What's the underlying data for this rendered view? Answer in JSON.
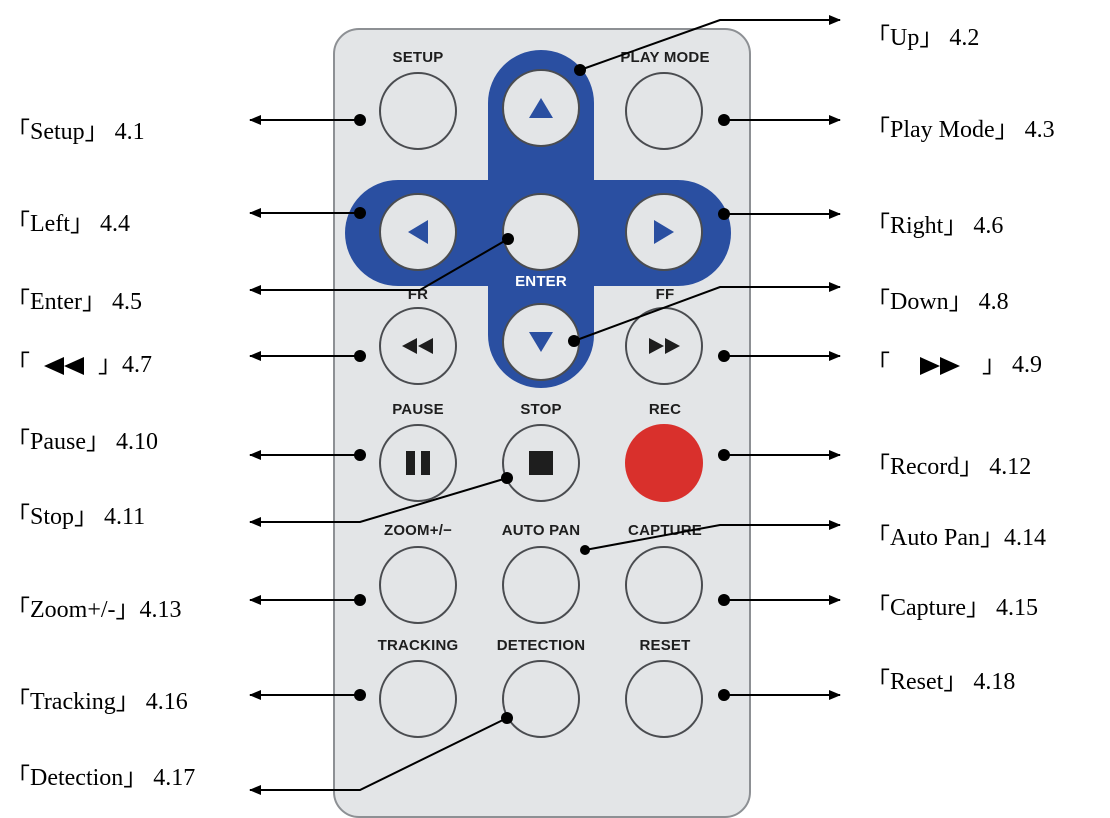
{
  "remote": {
    "body_color": "#e3e5e7",
    "dpad_color": "#2a4fa1",
    "record_color": "#d9302c",
    "buttons": {
      "setup": "SETUP",
      "play_mode": "PLAY MODE",
      "enter": "ENTER",
      "fr": "FR",
      "ff": "FF",
      "pause": "PAUSE",
      "stop": "STOP",
      "rec": "REC",
      "zoom": "ZOOM+/−",
      "auto_pan": "AUTO PAN",
      "capture": "CAPTURE",
      "tracking": "TRACKING",
      "detection": "DETECTION",
      "reset": "RESET"
    },
    "icons": {
      "up": "triangle-up-icon",
      "down": "triangle-down-icon",
      "left": "triangle-left-icon",
      "right": "triangle-right-icon",
      "fr": "rewind-icon",
      "ff": "fast-forward-icon",
      "pause": "pause-icon",
      "stop": "stop-icon"
    }
  },
  "callouts": {
    "setup": "「Setup」 4.1",
    "up": "「Up」 4.2",
    "play_mode": "「Play Mode」 4.3",
    "left": "「Left」 4.4",
    "enter": "「Enter」 4.5",
    "right": "「Right」 4.6",
    "fr_open": "「",
    "fr_close": "」4.7",
    "down": "「Down」 4.8",
    "ff_open": "「",
    "ff_close": "」 4.9",
    "pause": "「Pause」 4.10",
    "stop": "「Stop」 4.11",
    "record": "「Record」 4.12",
    "zoom": "「Zoom+/-」4.13",
    "auto_pan": "「Auto Pan」4.14",
    "capture": "「Capture」 4.15",
    "tracking": "「Tracking」 4.16",
    "detection": "「Detection」 4.17",
    "reset": "「Reset」 4.18"
  }
}
